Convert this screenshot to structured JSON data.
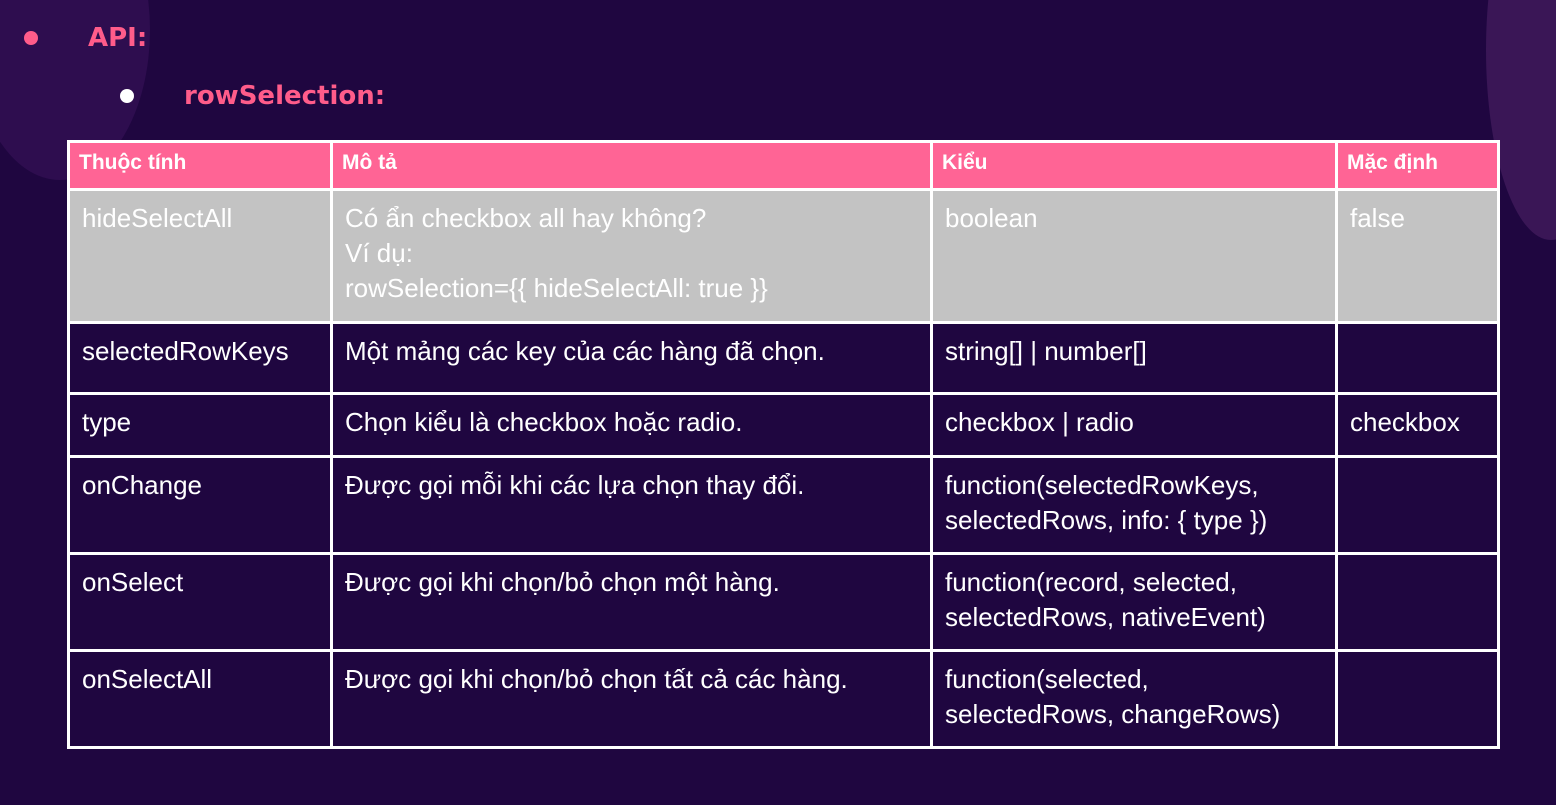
{
  "headings": {
    "api": "API:",
    "row_selection": "rowSelection:"
  },
  "colors": {
    "background": "#1f0640",
    "accent": "#ff5c8a",
    "header_bg": "#ff6495",
    "highlight_row": "#c3c3c3",
    "border": "#ffffff"
  },
  "table": {
    "columns": [
      "Thuộc tính",
      "Mô tả",
      "Kiểu",
      "Mặc định"
    ],
    "rows": [
      {
        "property": "hideSelectAll",
        "description": "Có ẩn checkbox all hay không?\nVí dụ:\nrowSelection={{ hideSelectAll: true }}",
        "type": "boolean",
        "default": "false"
      },
      {
        "property": "selectedRowKeys",
        "description": "Một mảng các key của các hàng đã chọn.",
        "type": "string[] | number[]",
        "default": ""
      },
      {
        "property": "type",
        "description": "Chọn kiểu là checkbox hoặc radio.",
        "type": "checkbox | radio",
        "default": "checkbox"
      },
      {
        "property": "onChange",
        "description": "Được gọi mỗi khi các lựa chọn thay đổi.",
        "type": "function(selectedRowKeys,\nselectedRows, info: { type })",
        "default": ""
      },
      {
        "property": "onSelect",
        "description": "Được gọi khi chọn/bỏ chọn một hàng.",
        "type": "function(record, selected,\nselectedRows, nativeEvent)",
        "default": ""
      },
      {
        "property": "onSelectAll",
        "description": "Được gọi khi chọn/bỏ chọn tất cả các hàng.",
        "type": "function(selected,\nselectedRows, changeRows)",
        "default": ""
      }
    ]
  }
}
